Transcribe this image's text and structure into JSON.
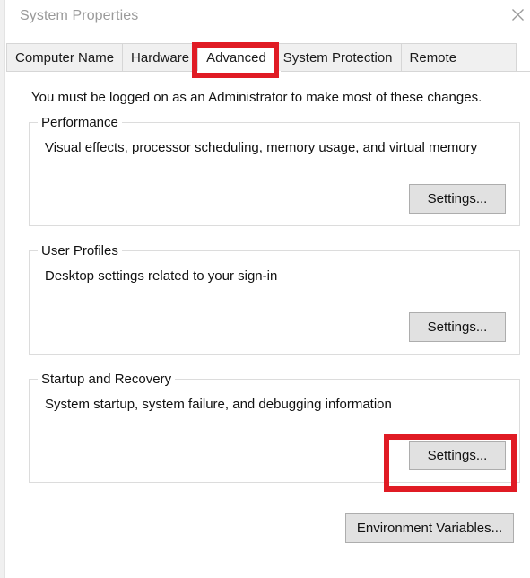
{
  "window": {
    "title": "System Properties",
    "close_icon": "close-icon"
  },
  "tabs": [
    {
      "label": "Computer Name",
      "selected": false
    },
    {
      "label": "Hardware",
      "selected": false
    },
    {
      "label": "Advanced",
      "selected": true
    },
    {
      "label": "System Protection",
      "selected": false
    },
    {
      "label": "Remote",
      "selected": false
    }
  ],
  "main": {
    "intro_text": "You must be logged on as an Administrator to make most of these changes.",
    "groups": [
      {
        "legend": "Performance",
        "description": "Visual effects, processor scheduling, memory usage, and virtual memory",
        "button_label": "Settings..."
      },
      {
        "legend": "User Profiles",
        "description": "Desktop settings related to your sign-in",
        "button_label": "Settings..."
      },
      {
        "legend": "Startup and Recovery",
        "description": "System startup, system failure, and debugging information",
        "button_label": "Settings..."
      }
    ],
    "environment_variables_label": "Environment Variables..."
  },
  "annotations": {
    "highlight_color": "#e01b24",
    "boxes": [
      {
        "target": "Advanced"
      },
      {
        "target": "Settings..."
      }
    ]
  }
}
